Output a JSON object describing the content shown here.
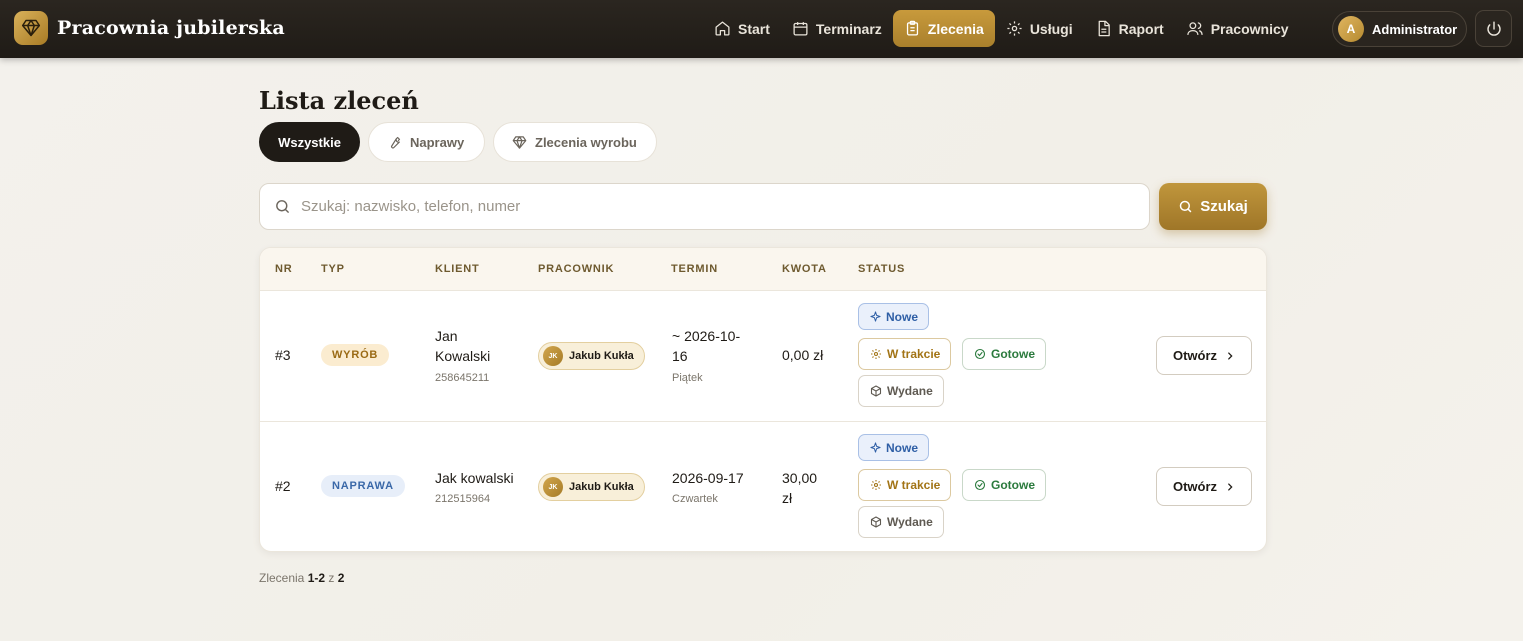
{
  "app": {
    "title": "Pracownia jubilerska"
  },
  "nav": [
    {
      "label": "Start",
      "icon": "home-icon",
      "active": false
    },
    {
      "label": "Terminarz",
      "icon": "calendar-icon",
      "active": false
    },
    {
      "label": "Zlecenia",
      "icon": "clipboard-icon",
      "active": true
    },
    {
      "label": "Usługi",
      "icon": "gear-icon",
      "active": false
    },
    {
      "label": "Raport",
      "icon": "document-icon",
      "active": false
    },
    {
      "label": "Pracownicy",
      "icon": "users-icon",
      "active": false
    }
  ],
  "user": {
    "initial": "A",
    "name": "Administrator"
  },
  "page": {
    "title": "Lista zleceń"
  },
  "tabs": [
    {
      "label": "Wszystkie",
      "active": true
    },
    {
      "label": "Naprawy",
      "icon": "wrench-icon",
      "active": false
    },
    {
      "label": "Zlecenia wyrobu",
      "icon": "diamond-icon",
      "active": false
    }
  ],
  "search": {
    "placeholder": "Szukaj: nazwisko, telefon, numer",
    "button_label": "Szukaj"
  },
  "table": {
    "columns": [
      "NR",
      "TYP",
      "KLIENT",
      "PRACOWNIK",
      "TERMIN",
      "KWOTA",
      "STATUS"
    ],
    "rows": [
      {
        "nr": "#3",
        "type": "WYRÓB",
        "client_name_1": "Jan",
        "client_name_2": "Kowalski",
        "client_phone": "258645211",
        "worker_initials": "JK",
        "worker_name": "Jakub Kukła",
        "term_1": "~ 2026-10-",
        "term_2": "16",
        "term_day": "Piątek",
        "amount_1": "0,00 zł",
        "amount_2": ""
      },
      {
        "nr": "#2",
        "type": "NAPRAWA",
        "client_name_1": "Jak kowalski",
        "client_name_2": "",
        "client_phone": "212515964",
        "worker_initials": "JK",
        "worker_name": "Jakub Kukła",
        "term_1": "2026-09-17",
        "term_2": "",
        "term_day": "Czwartek",
        "amount_1": "30,00",
        "amount_2": "zł"
      }
    ],
    "status_labels": {
      "new": "Nowe",
      "in_progress": "W trakcie",
      "done": "Gotowe",
      "issued": "Wydane"
    },
    "open_label": "Otwórz"
  },
  "footer": {
    "prefix": "Zlecenia",
    "range": "1-2",
    "of": "z",
    "total": "2"
  },
  "colors": {
    "accent": "#b8893a",
    "dark": "#1f1b16",
    "new": "#2f5fa6",
    "in_progress": "#a27416",
    "done": "#2b7a3d"
  }
}
